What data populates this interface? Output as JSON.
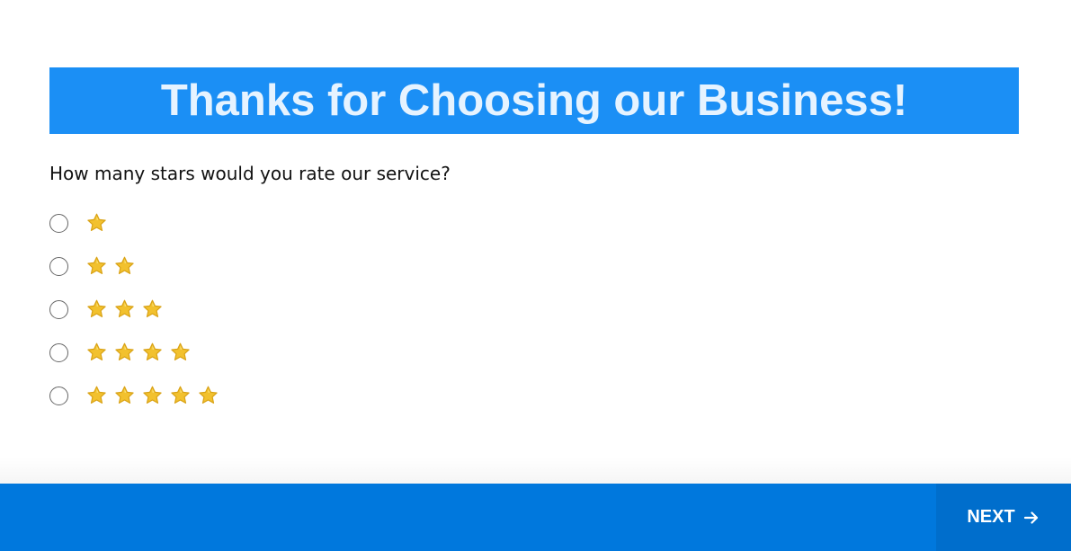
{
  "banner": {
    "title": "Thanks for Choosing our Business!"
  },
  "question": {
    "text": "How many stars would you rate our service?"
  },
  "options": [
    {
      "stars": 1,
      "selected": false
    },
    {
      "stars": 2,
      "selected": false
    },
    {
      "stars": 3,
      "selected": false
    },
    {
      "stars": 4,
      "selected": false
    },
    {
      "stars": 5,
      "selected": false
    }
  ],
  "footer": {
    "next_label": "NEXT",
    "next_icon": "arrow-right-icon"
  },
  "colors": {
    "banner_bg": "#1b8ff5",
    "banner_text": "#e6f3ff",
    "footer_bg": "#0078dd",
    "next_bg": "#006ecc",
    "star": "#f2c12e"
  }
}
